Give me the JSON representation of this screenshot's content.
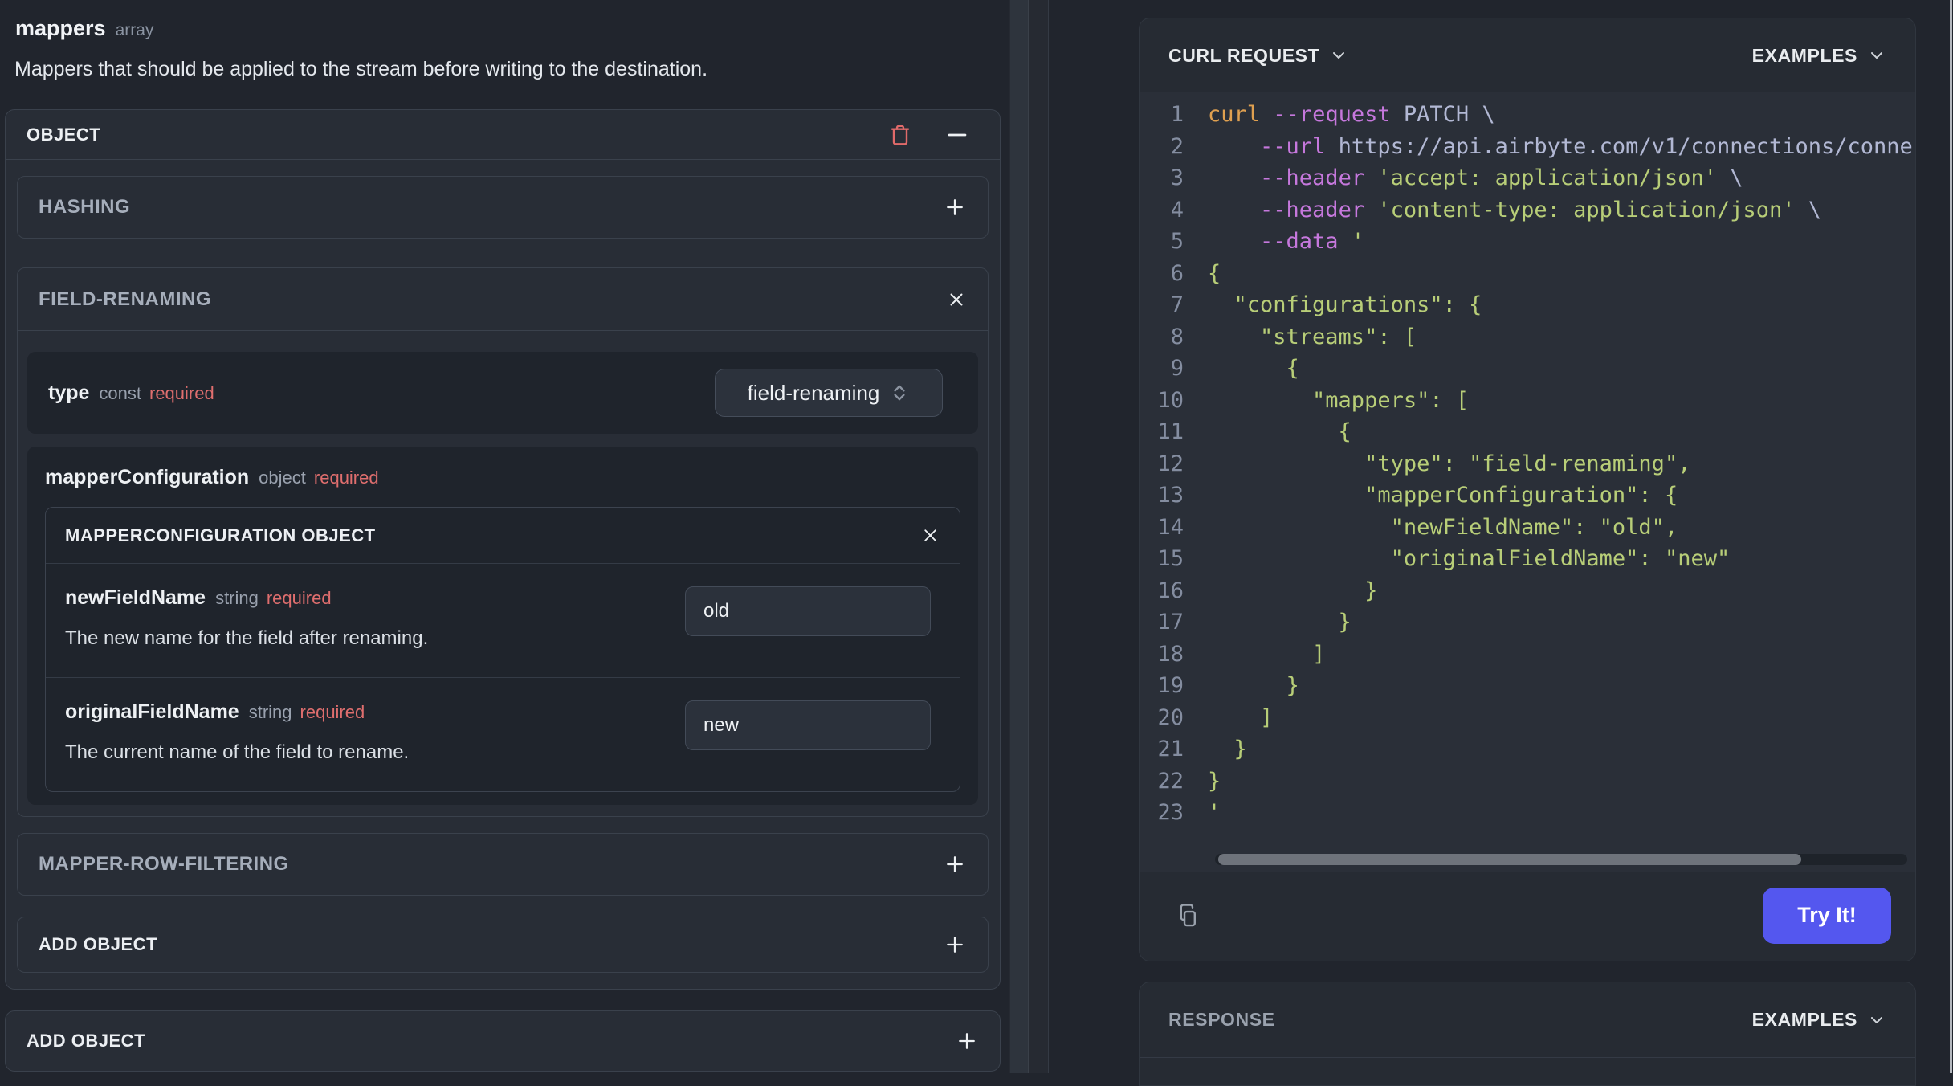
{
  "left_panel": {
    "field_title": "mappers",
    "field_type": "array",
    "description": "Mappers that should be applied to the stream before writing to the destination.",
    "object_card_header": "OBJECT",
    "hashing": {
      "label": "HASHING"
    },
    "field_renaming": {
      "label": "FIELD-RENAMING",
      "type_row": {
        "name": "type",
        "kind": "const",
        "required": "required",
        "value": "field-renaming"
      },
      "mapper_configuration": {
        "name": "mapperConfiguration",
        "kind": "object",
        "required": "required",
        "object_header": "MAPPERCONFIGURATION OBJECT",
        "fields": [
          {
            "name": "newFieldName",
            "kind": "string",
            "required": "required",
            "value": "old",
            "description": "The new name for the field after renaming."
          },
          {
            "name": "originalFieldName",
            "kind": "string",
            "required": "required",
            "value": "new",
            "description": "The current name of the field to rename."
          }
        ]
      }
    },
    "mapper_row_filtering": {
      "label": "MAPPER-ROW-FILTERING"
    },
    "add_object_inner": "ADD OBJECT",
    "add_object_outer": "ADD OBJECT"
  },
  "right_panel": {
    "curl_card": {
      "title": "CURL REQUEST",
      "examples_label": "EXAMPLES",
      "try_button": "Try It!",
      "code_lines": [
        {
          "n": 1,
          "segs": [
            [
              "curl",
              "cmd"
            ],
            [
              " ",
              "plain"
            ],
            [
              "--request",
              "flag"
            ],
            [
              " PATCH \\",
              "plain"
            ]
          ]
        },
        {
          "n": 2,
          "segs": [
            [
              "    ",
              "plain"
            ],
            [
              "--url",
              "flag"
            ],
            [
              " https://api.airbyte.com/v1/connections/conne",
              "plain"
            ]
          ]
        },
        {
          "n": 3,
          "segs": [
            [
              "    ",
              "plain"
            ],
            [
              "--header",
              "flag"
            ],
            [
              " ",
              "plain"
            ],
            [
              "'accept: application/json'",
              "str"
            ],
            [
              " \\",
              "plain"
            ]
          ]
        },
        {
          "n": 4,
          "segs": [
            [
              "    ",
              "plain"
            ],
            [
              "--header",
              "flag"
            ],
            [
              " ",
              "plain"
            ],
            [
              "'content-type: application/json'",
              "str"
            ],
            [
              " \\",
              "plain"
            ]
          ]
        },
        {
          "n": 5,
          "segs": [
            [
              "    ",
              "plain"
            ],
            [
              "--data",
              "flag"
            ],
            [
              " ",
              "plain"
            ],
            [
              "'",
              "str"
            ]
          ]
        },
        {
          "n": 6,
          "segs": [
            [
              "{",
              "str"
            ]
          ]
        },
        {
          "n": 7,
          "segs": [
            [
              "  \"configurations\": {",
              "str"
            ]
          ]
        },
        {
          "n": 8,
          "segs": [
            [
              "    \"streams\": [",
              "str"
            ]
          ]
        },
        {
          "n": 9,
          "segs": [
            [
              "      {",
              "str"
            ]
          ]
        },
        {
          "n": 10,
          "segs": [
            [
              "        \"mappers\": [",
              "str"
            ]
          ]
        },
        {
          "n": 11,
          "segs": [
            [
              "          {",
              "str"
            ]
          ]
        },
        {
          "n": 12,
          "segs": [
            [
              "            \"type\": \"field-renaming\",",
              "str"
            ]
          ]
        },
        {
          "n": 13,
          "segs": [
            [
              "            \"mapperConfiguration\": {",
              "str"
            ]
          ]
        },
        {
          "n": 14,
          "segs": [
            [
              "              \"newFieldName\": \"old\",",
              "str"
            ]
          ]
        },
        {
          "n": 15,
          "segs": [
            [
              "              \"originalFieldName\": \"new\"",
              "str"
            ]
          ]
        },
        {
          "n": 16,
          "segs": [
            [
              "            }",
              "str"
            ]
          ]
        },
        {
          "n": 17,
          "segs": [
            [
              "          }",
              "str"
            ]
          ]
        },
        {
          "n": 18,
          "segs": [
            [
              "        ]",
              "str"
            ]
          ]
        },
        {
          "n": 19,
          "segs": [
            [
              "      }",
              "str"
            ]
          ]
        },
        {
          "n": 20,
          "segs": [
            [
              "    ]",
              "str"
            ]
          ]
        },
        {
          "n": 21,
          "segs": [
            [
              "  }",
              "str"
            ]
          ]
        },
        {
          "n": 22,
          "segs": [
            [
              "}",
              "str"
            ]
          ]
        },
        {
          "n": 23,
          "segs": [
            [
              "'",
              "str"
            ]
          ]
        }
      ]
    },
    "response_card": {
      "title": "RESPONSE",
      "examples_label": "EXAMPLES"
    }
  },
  "colors": {
    "accent_button": "#5457ef",
    "required_red": "#df6e6e",
    "trash_red": "#e06a6a",
    "code": {
      "cmd": "#dfa050",
      "flag": "#c678dd",
      "plain": "#b2b8d4",
      "str": "#b8ce78",
      "lineno": "#848da0"
    }
  }
}
